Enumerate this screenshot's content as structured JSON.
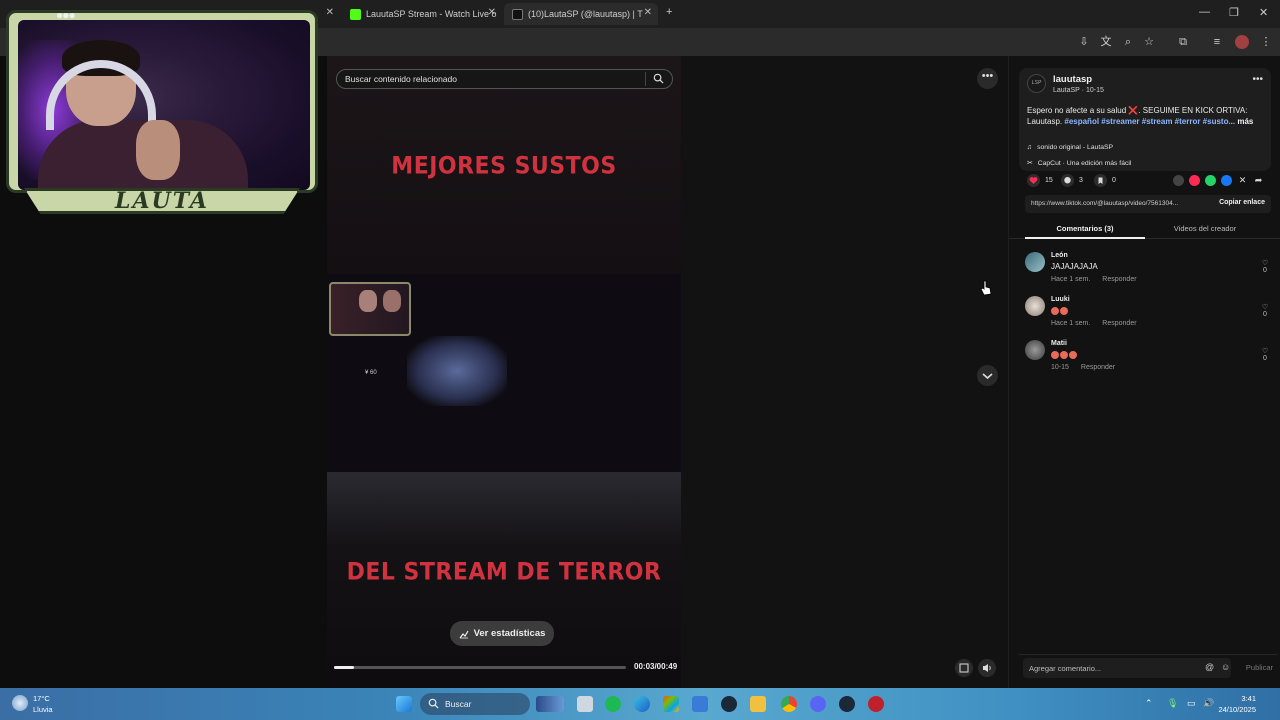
{
  "browser": {
    "tabs": [
      {
        "title": "LauutaSP Stream - Watch Live o"
      },
      {
        "title": "(10)LautaSP (@lauutasp) | T"
      }
    ]
  },
  "webcam": {
    "name": "LAUTA"
  },
  "video": {
    "search_placeholder": "Buscar contenido relacionado",
    "title_top": "MEJORES SUSTOS",
    "title_bottom": "DEL STREAM DE TERROR",
    "game_sign": "¥ 60",
    "stats_button": "Ver estadísticas",
    "time": "00:03/00:49",
    "progress": 0.07
  },
  "post": {
    "avatar_text": "LSP",
    "username": "lauutasp",
    "subname": "LautaSP · 10-15",
    "desc_lines": {
      "line1": "Espero no afecte a su salud ❌. SEGUIME EN KICK ORTIVA:",
      "line2_prefix": "Lauutasp. ",
      "tags": "#español #streamer #stream #terror #susto...",
      "more": "más"
    },
    "sound": "sonido original - LautaSP",
    "capcut": "CapCut · Una edición más fácil",
    "likes": "15",
    "comments": "3",
    "saves": "0",
    "link": "https://www.tiktok.com/@lauutasp/video/7561304...",
    "copy_label": "Copiar enlace",
    "tab_comments": "Comentarios (3)",
    "tab_creator": "Videos del creador"
  },
  "comments": [
    {
      "name": "León",
      "text": "JAJAJAJAJA",
      "time": "Hace 1 sem.",
      "reply": "Responder",
      "likes": "0"
    },
    {
      "name": "Luuki",
      "text": "",
      "emoji_count": 2,
      "time": "Hace 1 sem.",
      "reply": "Responder",
      "likes": "0"
    },
    {
      "name": "Matii",
      "text": "",
      "emoji_count": 3,
      "time": "10-15",
      "reply": "Responder",
      "likes": "0"
    }
  ],
  "comment_input": {
    "placeholder": "Agregar comentario...",
    "publish": "Publicar"
  },
  "taskbar": {
    "temp": "17°C",
    "weather": "Lluvia",
    "search": "Buscar",
    "time": "3:41",
    "date": "24/10/2025"
  },
  "colors": {
    "accent_red": "#d0333f",
    "tag_blue": "#8fb7ff",
    "like_pink": "#fe2c55"
  }
}
